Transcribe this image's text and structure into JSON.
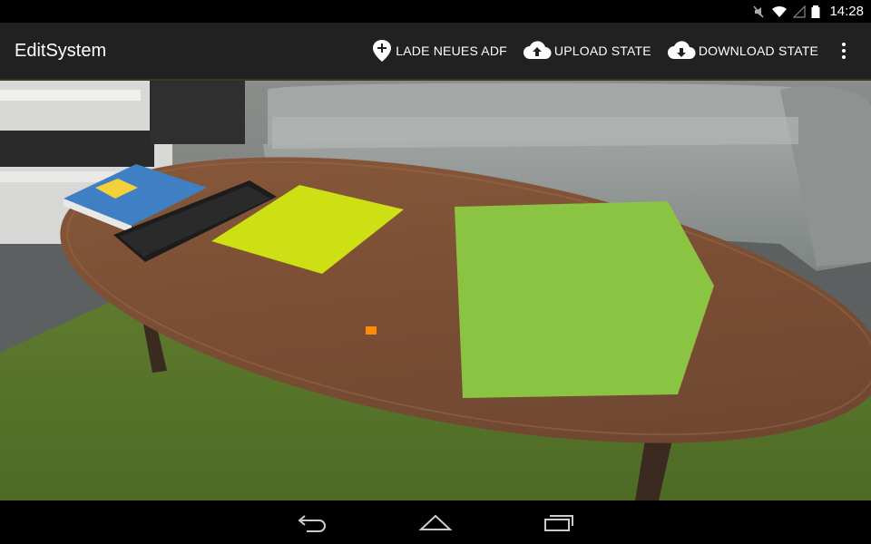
{
  "status_bar": {
    "time": "14:28"
  },
  "action_bar": {
    "title": "EditSystem",
    "actions": [
      {
        "label": "LADE NEUES ADF",
        "icon": "location-add-icon"
      },
      {
        "label": "UPLOAD STATE",
        "icon": "cloud-upload-icon"
      },
      {
        "label": "DOWNLOAD STATE",
        "icon": "cloud-download-icon"
      }
    ],
    "overflow_icon": "more-vert-icon"
  },
  "ar_scene": {
    "camera_feed": "living room with wooden coffee table, sofa, green rug",
    "objects": [
      {
        "name": "placed-plane",
        "color": "#cde014"
      },
      {
        "name": "placed-cube",
        "color": "#8bc443"
      },
      {
        "name": "anchor-marker",
        "color": "#ff8c00"
      }
    ]
  },
  "nav_bar": {
    "icons": [
      "back-icon",
      "home-icon",
      "recents-icon"
    ]
  },
  "colors": {
    "action_bar_bg": "#212121",
    "status_bar_bg": "#000000"
  }
}
